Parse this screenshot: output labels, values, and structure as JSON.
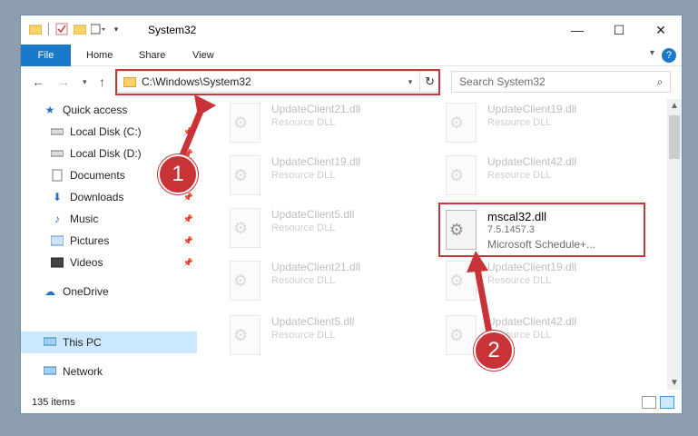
{
  "window": {
    "title": "System32",
    "controls": {
      "minimize": "—",
      "maximize": "☐",
      "close": "✕"
    }
  },
  "ribbon": {
    "tabs": [
      "File",
      "Home",
      "Share",
      "View"
    ],
    "help": "?"
  },
  "address_bar": {
    "path": "C:\\Windows\\System32",
    "search_placeholder": "Search System32"
  },
  "sidebar": {
    "items": [
      {
        "label": "Quick access",
        "icon": "star-icon",
        "pinned": false
      },
      {
        "label": "Local Disk (C:)",
        "icon": "drive-icon",
        "pinned": true
      },
      {
        "label": "Local Disk (D:)",
        "icon": "drive-icon",
        "pinned": true
      },
      {
        "label": "Documents",
        "icon": "documents-icon",
        "pinned": true
      },
      {
        "label": "Downloads",
        "icon": "download-icon",
        "pinned": true
      },
      {
        "label": "Music",
        "icon": "music-icon",
        "pinned": true
      },
      {
        "label": "Pictures",
        "icon": "pictures-icon",
        "pinned": true
      },
      {
        "label": "Videos",
        "icon": "videos-icon",
        "pinned": true
      },
      {
        "label": "OneDrive",
        "icon": "cloud-icon",
        "pinned": false
      },
      {
        "label": "This PC",
        "icon": "computer-icon",
        "pinned": false,
        "selected": true
      },
      {
        "label": "Network",
        "icon": "network-icon",
        "pinned": false
      }
    ]
  },
  "files": [
    {
      "name": "UpdateClient21.dll",
      "type": "Resource DLL"
    },
    {
      "name": "UpdateClient19.dll",
      "type": "Resource DLL"
    },
    {
      "name": "UpdateClient19.dll",
      "type": "Resource DLL"
    },
    {
      "name": "UpdateClient42.dll",
      "type": "Resource DLL"
    },
    {
      "name": "UpdateClient5.dll",
      "type": "Resource DLL"
    },
    {
      "name": "mscal32.dll",
      "type": "7.5.1457.3",
      "desc": "Microsoft Schedule+...",
      "active": true
    },
    {
      "name": "UpdateClient21.dll",
      "type": "Resource DLL"
    },
    {
      "name": "UpdateClient19.dll",
      "type": "Resource DLL"
    },
    {
      "name": "UpdateClient5.dll",
      "type": "Resource DLL"
    },
    {
      "name": "UpdateClient42.dll",
      "type": "Resource DLL"
    }
  ],
  "status": {
    "item_count": "135 items"
  },
  "annotations": {
    "step1": "1",
    "step2": "2"
  },
  "colors": {
    "accent": "#1979ca",
    "highlight": "#c9363a",
    "selection": "#cce8ff"
  }
}
